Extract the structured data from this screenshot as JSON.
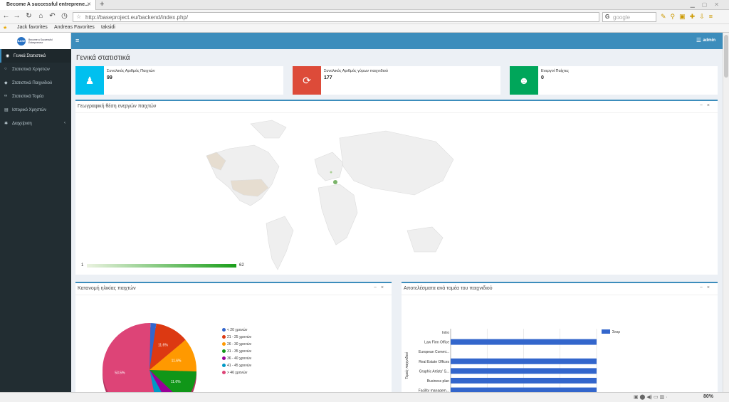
{
  "browser": {
    "tab_title": "Become A successful entreprene...",
    "url": "http://baseproject.eu/backend/index.php/",
    "search_placeholder": "google",
    "bookmarks": [
      "Jack favorites",
      "Andreas Favorites",
      "taksidi"
    ],
    "zoom": "80%"
  },
  "brand": {
    "line1": "Become a Successful",
    "line2": "Entrepreneur",
    "mark": "BASE"
  },
  "sidebar": {
    "items": [
      {
        "label": "Γενικά Στατιστικά",
        "active": true
      },
      {
        "label": "Στατιστικά Χρηστών"
      },
      {
        "label": "Στατιστικά Παιχνιδιού"
      },
      {
        "label": "Στατιστικά Τομέα"
      },
      {
        "label": "Ιστορικό Χρηστών"
      },
      {
        "label": "Διαχείριση"
      }
    ]
  },
  "header": {
    "user": "admin"
  },
  "page": {
    "title": "Γενικά στατιστικά"
  },
  "stats": [
    {
      "label": "Συνολικός Αριθμός Παιχτών",
      "value": "99",
      "color": "#00c0ef"
    },
    {
      "label": "Συνολικός Αριθμός γύρων παιχνιδιού",
      "value": "177",
      "color": "#dd4b39"
    },
    {
      "label": "Ενεργοί Παίχτες",
      "value": "0",
      "color": "#00a65a"
    }
  ],
  "map_panel": {
    "title": "Γεωγραφική θέση ενεργών παιχτών",
    "scale_min": "1",
    "scale_max": "62"
  },
  "age_panel": {
    "title": "Κατανομή ηλικίας παιχτών"
  },
  "sector_panel": {
    "title": "Αποτελέσματα ανά τομέα του παιχνιδιού"
  },
  "chart_data": [
    {
      "type": "pie",
      "labels": [
        "< 20 χρονών",
        "21 - 25 χρονών",
        "26 - 30 χρονών",
        "31 - 35 χρονών",
        "36 - 40 χρονών",
        "41 - 45 χρονών",
        "> 46 χρονών"
      ],
      "values": [
        2.0,
        11.6,
        11.6,
        11.6,
        5.0,
        4.7,
        53.5
      ],
      "data_labels": [
        "",
        "11.6%",
        "11.6%",
        "11.6%",
        "",
        "",
        "53.5%"
      ],
      "colors": [
        "#3366cc",
        "#dc3912",
        "#ff9900",
        "#109618",
        "#990099",
        "#0099c6",
        "#dd4477"
      ]
    },
    {
      "type": "bar",
      "orientation": "horizontal",
      "categories": [
        "Intro",
        "Law Firm Office",
        "European Commi...",
        "Real Estate Offices",
        "Graphic Artists' S...",
        "Business plan",
        "Facility managem..."
      ],
      "series": [
        {
          "name": "Σκορ",
          "values": [
            0,
            100,
            0,
            100,
            100,
            100,
            100
          ],
          "color": "#3366cc"
        }
      ],
      "ylabel": "Τομείς παιχνιδιού"
    }
  ]
}
